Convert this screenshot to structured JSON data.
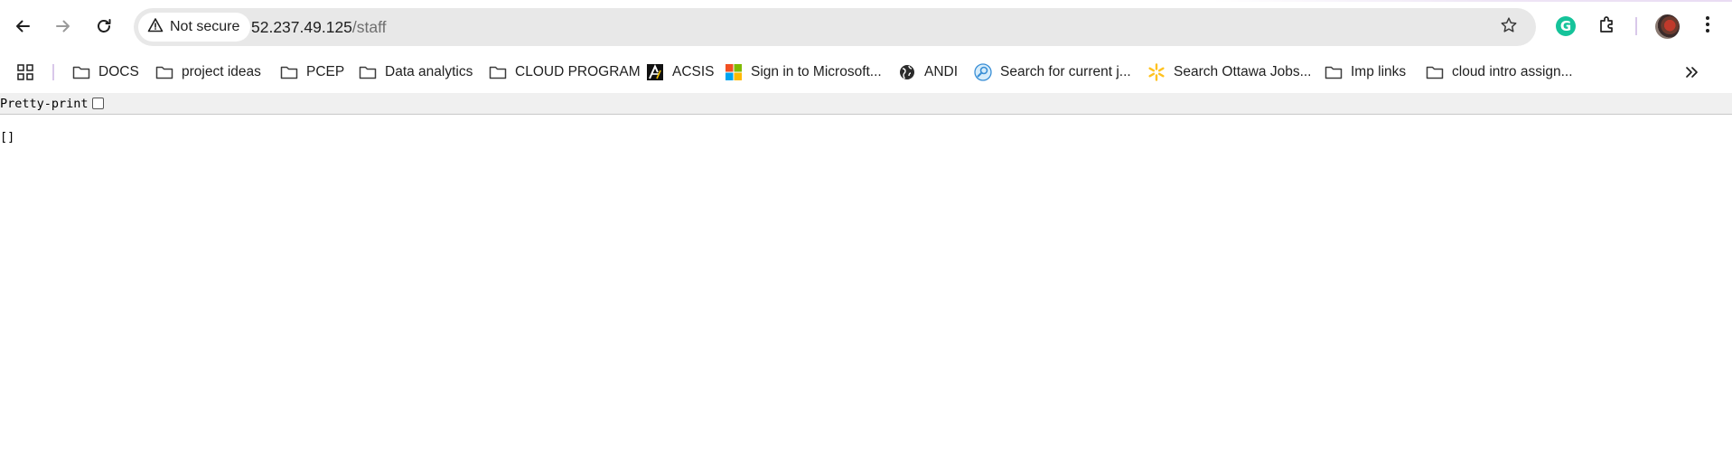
{
  "browser": {
    "nav": {
      "back_icon": "arrow-left-icon",
      "forward_icon": "arrow-right-icon",
      "reload_icon": "reload-icon"
    },
    "omnibox": {
      "security_label": "Not secure",
      "url_host": "52.237.49.125",
      "url_path": "/staff"
    },
    "extensions": {
      "grammarly_letter": "G"
    },
    "colors": {
      "omnibox_bg": "#e8e8e8",
      "grammarly": "#15c39a",
      "separator": "#d9c8ea"
    }
  },
  "bookmarks": {
    "items": [
      {
        "label": "DOCS",
        "icon": "folder-icon"
      },
      {
        "label": "project ideas",
        "icon": "folder-icon"
      },
      {
        "label": "PCEP",
        "icon": "folder-icon"
      },
      {
        "label": "Data analytics",
        "icon": "folder-icon"
      },
      {
        "label": "CLOUD PROGRAM",
        "icon": "folder-icon"
      },
      {
        "label": "ACSIS",
        "icon": "acsis-logo-icon"
      },
      {
        "label": "Sign in to Microsoft...",
        "icon": "microsoft-logo-icon"
      },
      {
        "label": "ANDI",
        "icon": "globe-icon"
      },
      {
        "label": "Search for current j...",
        "icon": "job-search-icon"
      },
      {
        "label": "Search Ottawa Jobs...",
        "icon": "sparkle-icon"
      },
      {
        "label": "Imp links",
        "icon": "folder-icon"
      },
      {
        "label": "cloud intro assign...",
        "icon": "folder-icon"
      }
    ]
  },
  "page": {
    "pretty_print_label": "Pretty-print",
    "json_content": "[]"
  }
}
